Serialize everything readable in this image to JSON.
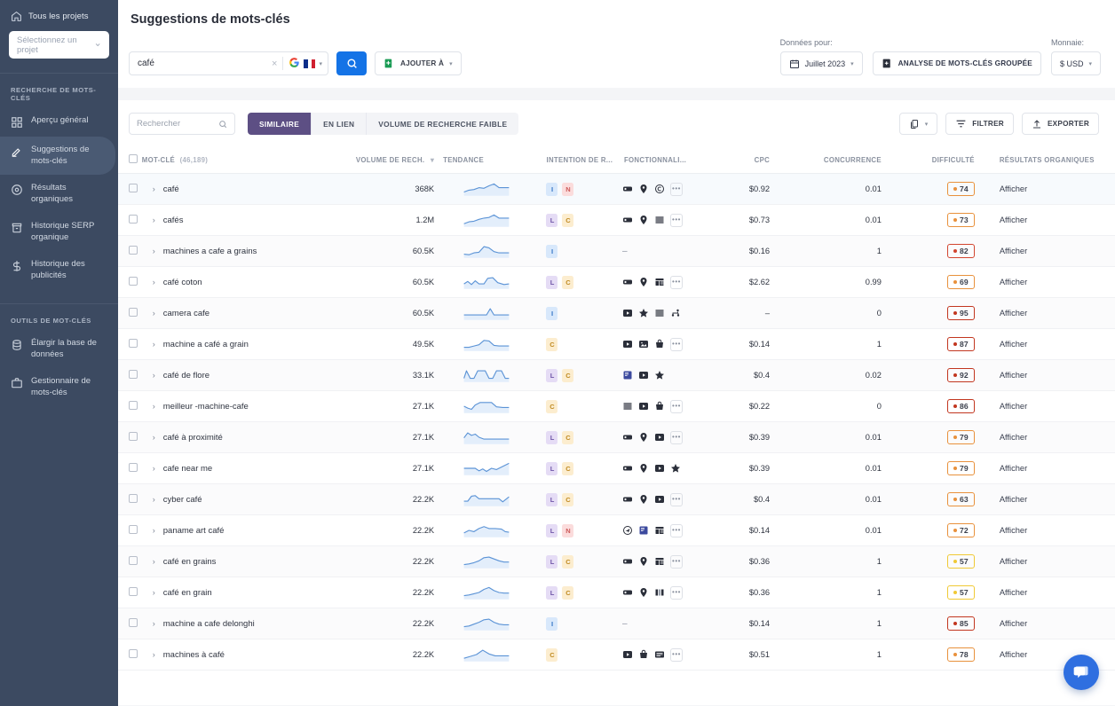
{
  "sidebar": {
    "all_projects": "Tous les projets",
    "project_select": "Sélectionnez un projet",
    "section1_title": "RECHERCHE DE MOTS-CLÉS",
    "section1_items": [
      {
        "label": "Aperçu général",
        "icon": "grid-icon"
      },
      {
        "label": "Suggestions de mots-clés",
        "icon": "pencil-icon"
      },
      {
        "label": "Résultats organiques",
        "icon": "target-icon"
      },
      {
        "label": "Historique SERP organique",
        "icon": "archive-icon"
      },
      {
        "label": "Historique des publicités",
        "icon": "dollar-icon"
      }
    ],
    "section2_title": "OUTILS DE MOT-CLÉS",
    "section2_items": [
      {
        "label": "Élargir la base de données",
        "icon": "database-icon"
      },
      {
        "label": "Gestionnaire de mots-clés",
        "icon": "briefcase-icon"
      }
    ],
    "active_index": 1
  },
  "header": {
    "title": "Suggestions de mots-clés",
    "search_value": "café",
    "search_clear": "×",
    "google_letter": "G",
    "search_button_icon": "magnifier-icon",
    "add_to_label": "AJOUTER À",
    "data_for_label": "Données pour:",
    "date_value": "Juillet 2023",
    "bulk_analysis_label": "ANALYSE DE MOTS-CLÉS GROUPÉE",
    "currency_label": "Monnaie:",
    "currency_value": "$ USD"
  },
  "toolbar": {
    "search_placeholder": "Rechercher",
    "tabs": [
      {
        "label": "SIMILAIRE",
        "active": true
      },
      {
        "label": "EN LIEN",
        "active": false
      },
      {
        "label": "VOLUME DE RECHERCHE FAIBLE",
        "active": false
      }
    ],
    "copy_label": "",
    "filter_label": "FILTRER",
    "export_label": "EXPORTER"
  },
  "table": {
    "columns": {
      "keyword": "MOT-CLÉ",
      "keyword_count": "(46,189)",
      "volume": "VOLUME DE RECH.",
      "trend": "TENDANCE",
      "intent": "INTENTION DE R...",
      "features": "FONCTIONNALI...",
      "cpc": "CPC",
      "competition": "CONCURRENCE",
      "difficulty": "DIFFICULTÉ",
      "organic": "RÉSULTATS ORGANIQUES"
    },
    "view_link": "Afficher",
    "rows": [
      {
        "keyword": "café",
        "volume": "368K",
        "intents": [
          "I",
          "N"
        ],
        "features": [
          "card",
          "pin",
          "circle"
        ],
        "more": true,
        "cpc": "$0.92",
        "competition": "0.01",
        "difficulty": "74",
        "difficulty_color": "#e8913c",
        "spark": "8,16 16,13 24,12 32,9 40,10 48,6 56,3 64,9 72,9 80,9"
      },
      {
        "keyword": "cafés",
        "volume": "1.2M",
        "intents": [
          "L",
          "C"
        ],
        "features": [
          "card",
          "pin",
          "lines"
        ],
        "more": true,
        "cpc": "$0.73",
        "competition": "0.01",
        "difficulty": "73",
        "difficulty_color": "#e8913c",
        "spark": "8,17 16,14 24,13 32,10 40,8 48,7 56,3 64,8 72,8 80,8"
      },
      {
        "keyword": "machines a cafe a grains",
        "volume": "60.5K",
        "intents": [
          "I"
        ],
        "features": [],
        "more": false,
        "cpc": "$0.16",
        "competition": "1",
        "difficulty": "82",
        "difficulty_color": "#d2452f",
        "spark": "8,16 16,17 24,14 32,13 40,4 48,6 56,12 64,14 72,14 80,14"
      },
      {
        "keyword": "café coton",
        "volume": "60.5K",
        "intents": [
          "L",
          "C"
        ],
        "features": [
          "card",
          "pin",
          "table"
        ],
        "more": true,
        "cpc": "$2.62",
        "competition": "0.99",
        "difficulty": "69",
        "difficulty_color": "#e8913c",
        "spark": "8,14 14,10 20,15 26,9 32,14 40,14 46,5 54,4 62,12 72,15 80,14"
      },
      {
        "keyword": "camera cafe",
        "volume": "60.5K",
        "intents": [
          "I"
        ],
        "features": [
          "video",
          "star",
          "lines",
          "sitelinks"
        ],
        "more": false,
        "cpc": "–",
        "competition": "0",
        "difficulty": "95",
        "difficulty_color": "#c2361f",
        "spark": "8,14 20,14 32,14 44,14 50,4 56,14 64,14 72,14 80,14"
      },
      {
        "keyword": "machine a café a grain",
        "volume": "49.5K",
        "intents": [
          "C"
        ],
        "features": [
          "video",
          "image",
          "cart"
        ],
        "more": true,
        "cpc": "$0.14",
        "competition": "1",
        "difficulty": "87",
        "difficulty_color": "#c2361f",
        "spark": "8,16 16,16 24,14 32,12 40,5 48,6 56,13 64,14 72,14 80,14"
      },
      {
        "keyword": "café de flore",
        "volume": "33.1K",
        "intents": [
          "L",
          "C"
        ],
        "features": [
          "news",
          "video",
          "star"
        ],
        "more": false,
        "cpc": "$0.4",
        "competition": "0.02",
        "difficulty": "92",
        "difficulty_color": "#c2361f",
        "spark": "8,16 12,4 18,16 24,16 30,4 42,4 48,16 54,16 60,4 68,4 74,16 80,16"
      },
      {
        "keyword": "meilleur -machine-cafe",
        "volume": "27.1K",
        "intents": [
          "C"
        ],
        "features": [
          "lines",
          "video",
          "cart"
        ],
        "more": true,
        "cpc": "$0.22",
        "competition": "0",
        "difficulty": "86",
        "difficulty_color": "#c2361f",
        "spark": "8,11 14,14 20,16 26,9 34,5 42,5 52,5 60,12 70,13 80,13"
      },
      {
        "keyword": "café à proximité",
        "volume": "27.1K",
        "intents": [
          "L",
          "C"
        ],
        "features": [
          "card",
          "pin",
          "video"
        ],
        "more": true,
        "cpc": "$0.39",
        "competition": "0.01",
        "difficulty": "79",
        "difficulty_color": "#e8913c",
        "spark": "8,12 14,4 20,8 26,6 32,11 40,14 50,14 60,14 70,14 80,14"
      },
      {
        "keyword": "cafe near me",
        "volume": "27.1K",
        "intents": [
          "L",
          "C"
        ],
        "features": [
          "card",
          "pin",
          "video",
          "star"
        ],
        "more": false,
        "cpc": "$0.39",
        "competition": "0.01",
        "difficulty": "79",
        "difficulty_color": "#e8913c",
        "spark": "8,11 18,11 26,11 32,15 38,12 44,16 52,11 60,13 70,8 80,3"
      },
      {
        "keyword": "cyber café",
        "volume": "22.2K",
        "intents": [
          "L",
          "C"
        ],
        "features": [
          "card",
          "pin",
          "video"
        ],
        "more": true,
        "cpc": "$0.4",
        "competition": "0.01",
        "difficulty": "63",
        "difficulty_color": "#e8913c",
        "spark": "8,14 14,14 20,6 26,5 32,10 44,10 56,10 64,10 70,15 80,7"
      },
      {
        "keyword": "paname art café",
        "volume": "22.2K",
        "intents": [
          "L",
          "N"
        ],
        "features": [
          "flight",
          "news",
          "table"
        ],
        "more": true,
        "cpc": "$0.14",
        "competition": "0.01",
        "difficulty": "72",
        "difficulty_color": "#e8913c",
        "spark": "8,15 16,11 24,13 32,8 40,5 48,8 58,8 68,9 74,13 80,14"
      },
      {
        "keyword": "café en grains",
        "volume": "22.2K",
        "intents": [
          "L",
          "C"
        ],
        "features": [
          "card",
          "pin",
          "table"
        ],
        "more": true,
        "cpc": "$0.36",
        "competition": "1",
        "difficulty": "57",
        "difficulty_color": "#f0c935",
        "spark": "8,16 16,15 24,13 32,10 40,5 48,4 56,7 64,10 72,12 80,12"
      },
      {
        "keyword": "café en grain",
        "volume": "22.2K",
        "intents": [
          "L",
          "C"
        ],
        "features": [
          "card",
          "pin",
          "carousel"
        ],
        "more": true,
        "cpc": "$0.36",
        "competition": "1",
        "difficulty": "57",
        "difficulty_color": "#f0c935",
        "spark": "8,16 16,15 24,13 32,11 40,6 48,3 56,8 64,11 72,12 80,12"
      },
      {
        "keyword": "machine a cafe delonghi",
        "volume": "22.2K",
        "intents": [
          "I"
        ],
        "features": [],
        "more": false,
        "cpc": "$0.14",
        "competition": "1",
        "difficulty": "85",
        "difficulty_color": "#c2361f",
        "spark": "8,16 16,15 24,12 32,9 40,5 48,4 56,9 64,12 72,13 80,13"
      },
      {
        "keyword": "machines à café",
        "volume": "22.2K",
        "intents": [
          "C"
        ],
        "features": [
          "video",
          "cart",
          "shopping"
        ],
        "more": true,
        "cpc": "$0.51",
        "competition": "1",
        "difficulty": "78",
        "difficulty_color": "#e8913c",
        "spark": "8,17 18,14 28,11 38,4 48,10 58,13 68,13 80,13"
      }
    ]
  },
  "colors": {
    "sidebar_bg": "#3c4a61",
    "accent_purple": "#5d4f84",
    "accent_blue": "#1473e6",
    "chat_blue": "#2f6fe0"
  },
  "chat": {
    "icon": "chat-bubble-icon"
  }
}
